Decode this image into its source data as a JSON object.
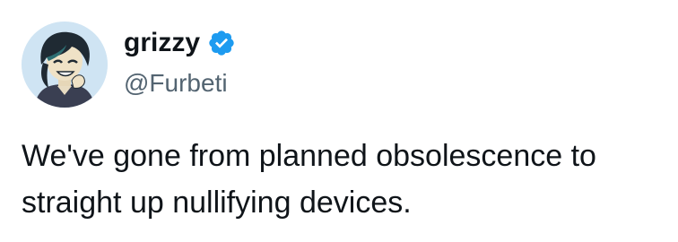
{
  "author": {
    "display_name": "grizzy",
    "handle": "@Furbeti",
    "verified": true,
    "avatar_icon": "cartoon-character-avatar",
    "verified_icon": "verified-badge-icon"
  },
  "tweet": {
    "lines": [
      "We've gone from planned obsolescence to",
      "straight up nullifying devices."
    ]
  },
  "colors": {
    "text": "#0f1419",
    "secondary": "#536471",
    "verified_blue": "#1d9bf0",
    "background": "#ffffff"
  }
}
